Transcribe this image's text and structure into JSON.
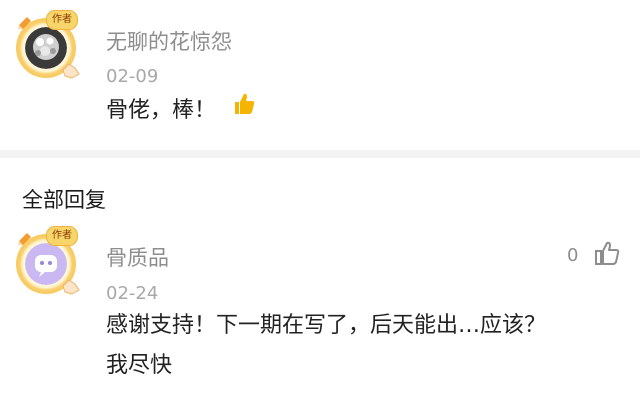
{
  "comment": {
    "username": "无聊的花惊怨",
    "badge": "作者",
    "date": "02-09",
    "text": "骨佬，棒！",
    "emoji": "👍"
  },
  "replies_section": {
    "title": "全部回复"
  },
  "reply": {
    "username": "骨质品",
    "badge": "作者",
    "date": "02-24",
    "text_line1": "感谢支持！下一期在写了，后天能出…应该？",
    "text_line2": "我尽快",
    "like_count": "0"
  },
  "colors": {
    "badge_bg": "#f7d56a",
    "avatar2_bg": "#c9b8f2",
    "thumbs_yellow": "#f4b400"
  }
}
